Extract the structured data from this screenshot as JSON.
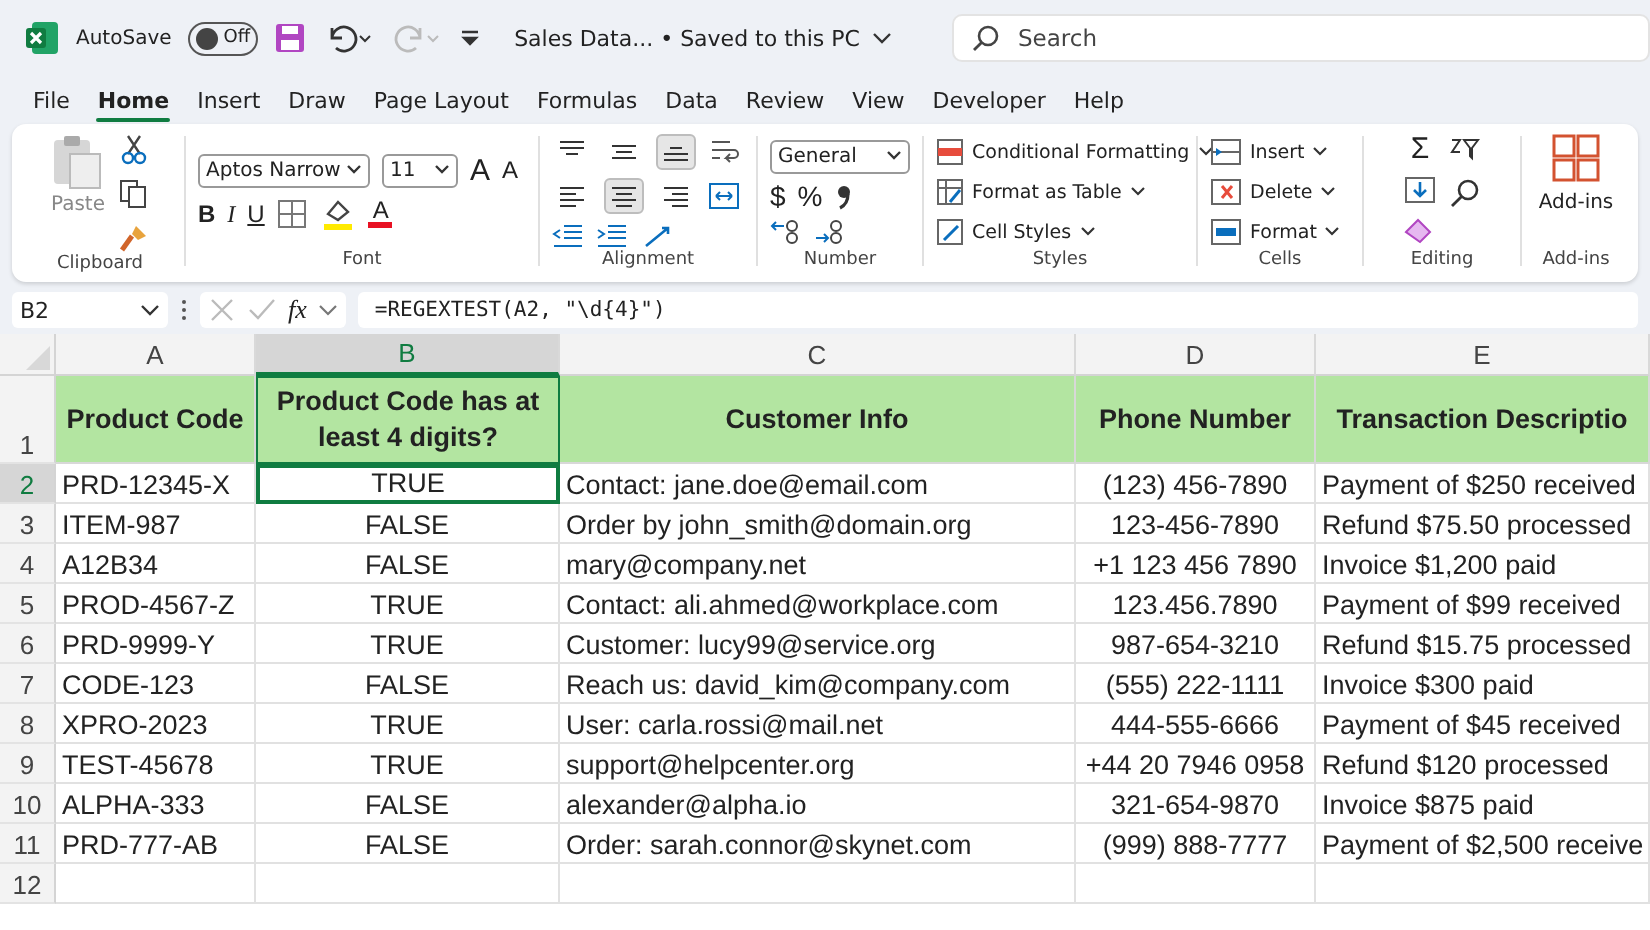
{
  "title_bar": {
    "autosave_label": "AutoSave",
    "autosave_toggle": {
      "label": "Off",
      "on": false
    },
    "document_title": "Sales Data...  •  Saved to this PC",
    "search": {
      "placeholder": "Search"
    }
  },
  "menu_tabs": [
    {
      "label": "File",
      "selected": false
    },
    {
      "label": "Home",
      "selected": true
    },
    {
      "label": "Insert",
      "selected": false
    },
    {
      "label": "Draw",
      "selected": false
    },
    {
      "label": "Page Layout",
      "selected": false
    },
    {
      "label": "Formulas",
      "selected": false
    },
    {
      "label": "Data",
      "selected": false
    },
    {
      "label": "Review",
      "selected": false
    },
    {
      "label": "View",
      "selected": false
    },
    {
      "label": "Developer",
      "selected": false
    },
    {
      "label": "Help",
      "selected": false
    }
  ],
  "ribbon": {
    "clipboard": {
      "label": "Clipboard",
      "paste": "Paste"
    },
    "font": {
      "label": "Font",
      "family": "Aptos Narrow",
      "size": "11",
      "grow": "A",
      "shrink": "A",
      "bold": "B",
      "italic": "I",
      "underline": "U",
      "font_color": "A"
    },
    "alignment": {
      "label": "Alignment",
      "vertical": [
        {
          "kind": "top",
          "selected": false
        },
        {
          "kind": "middle",
          "selected": false
        },
        {
          "kind": "bottom",
          "selected": true
        }
      ],
      "horizontal": [
        {
          "kind": "left",
          "selected": false
        },
        {
          "kind": "center",
          "selected": true
        },
        {
          "kind": "right",
          "selected": false
        }
      ]
    },
    "number": {
      "label": "Number",
      "format": "General",
      "currency": "$",
      "percent": "%"
    },
    "styles": {
      "label": "Styles",
      "items": [
        {
          "kind": "conditional",
          "label": "Conditional Formatting"
        },
        {
          "kind": "table",
          "label": "Format as Table"
        },
        {
          "kind": "cell",
          "label": "Cell Styles"
        }
      ]
    },
    "cells": {
      "label": "Cells",
      "items": [
        {
          "kind": "insert",
          "label": "Insert"
        },
        {
          "kind": "delete",
          "label": "Delete"
        },
        {
          "kind": "format",
          "label": "Format"
        }
      ]
    },
    "editing": {
      "label": "Editing",
      "sum": "Σ"
    },
    "addins": {
      "label": "Add-ins",
      "button": "Add-ins"
    }
  },
  "formula_bar": {
    "name_box": "B2",
    "fx": "fx",
    "formula": "=REGEXTEST(A2, \"\\d{4}\")"
  },
  "sheet": {
    "columns": [
      {
        "letter": "A",
        "selected": false
      },
      {
        "letter": "B",
        "selected": true
      },
      {
        "letter": "C",
        "selected": false
      },
      {
        "letter": "D",
        "selected": false
      },
      {
        "letter": "E",
        "selected": false
      }
    ],
    "header_row": {
      "number": "1",
      "cells": [
        "Product Code",
        "Product Code has at least 4 digits?",
        "Customer Info",
        "Phone Number",
        "Transaction Descriptio"
      ]
    },
    "rows": [
      {
        "number": "2",
        "cells": [
          {
            "text": "PRD-12345-X",
            "selected": false
          },
          {
            "text": "TRUE",
            "selected": true
          },
          {
            "text": "Contact: jane.doe@email.com",
            "selected": false
          },
          {
            "text": "(123) 456-7890",
            "selected": false
          },
          {
            "text": "Payment of $250 received",
            "selected": false
          }
        ]
      },
      {
        "number": "3",
        "cells": [
          {
            "text": "ITEM-987",
            "selected": false
          },
          {
            "text": "FALSE",
            "selected": false
          },
          {
            "text": "Order by john_smith@domain.org",
            "selected": false
          },
          {
            "text": "123-456-7890",
            "selected": false
          },
          {
            "text": "Refund $75.50 processed",
            "selected": false
          }
        ]
      },
      {
        "number": "4",
        "cells": [
          {
            "text": "A12B34",
            "selected": false
          },
          {
            "text": "FALSE",
            "selected": false
          },
          {
            "text": "mary@company.net",
            "selected": false
          },
          {
            "text": "+1 123 456 7890",
            "selected": false
          },
          {
            "text": "Invoice $1,200 paid",
            "selected": false
          }
        ]
      },
      {
        "number": "5",
        "cells": [
          {
            "text": "PROD-4567-Z",
            "selected": false
          },
          {
            "text": "TRUE",
            "selected": false
          },
          {
            "text": "Contact: ali.ahmed@workplace.com",
            "selected": false
          },
          {
            "text": "123.456.7890",
            "selected": false
          },
          {
            "text": "Payment of $99 received",
            "selected": false
          }
        ]
      },
      {
        "number": "6",
        "cells": [
          {
            "text": "PRD-9999-Y",
            "selected": false
          },
          {
            "text": "TRUE",
            "selected": false
          },
          {
            "text": "Customer: lucy99@service.org",
            "selected": false
          },
          {
            "text": "987-654-3210",
            "selected": false
          },
          {
            "text": "Refund $15.75 processed",
            "selected": false
          }
        ]
      },
      {
        "number": "7",
        "cells": [
          {
            "text": "CODE-123",
            "selected": false
          },
          {
            "text": "FALSE",
            "selected": false
          },
          {
            "text": "Reach us: david_kim@company.com",
            "selected": false
          },
          {
            "text": "(555) 222-1111",
            "selected": false
          },
          {
            "text": "Invoice $300 paid",
            "selected": false
          }
        ]
      },
      {
        "number": "8",
        "cells": [
          {
            "text": "XPRO-2023",
            "selected": false
          },
          {
            "text": "TRUE",
            "selected": false
          },
          {
            "text": "User: carla.rossi@mail.net",
            "selected": false
          },
          {
            "text": "444-555-6666",
            "selected": false
          },
          {
            "text": "Payment of $45 received",
            "selected": false
          }
        ]
      },
      {
        "number": "9",
        "cells": [
          {
            "text": "TEST-45678",
            "selected": false
          },
          {
            "text": "TRUE",
            "selected": false
          },
          {
            "text": "support@helpcenter.org",
            "selected": false
          },
          {
            "text": "+44 20 7946 0958",
            "selected": false
          },
          {
            "text": "Refund $120 processed",
            "selected": false
          }
        ]
      },
      {
        "number": "10",
        "cells": [
          {
            "text": "ALPHA-333",
            "selected": false
          },
          {
            "text": "FALSE",
            "selected": false
          },
          {
            "text": "alexander@alpha.io",
            "selected": false
          },
          {
            "text": "321-654-9870",
            "selected": false
          },
          {
            "text": "Invoice $875 paid",
            "selected": false
          }
        ]
      },
      {
        "number": "11",
        "cells": [
          {
            "text": "PRD-777-AB",
            "selected": false
          },
          {
            "text": "FALSE",
            "selected": false
          },
          {
            "text": "Order: sarah.connor@skynet.com",
            "selected": false
          },
          {
            "text": "(999) 888-7777",
            "selected": false
          },
          {
            "text": "Payment of $2,500 receive",
            "selected": false
          }
        ]
      }
    ],
    "empty_rows": [
      "12"
    ]
  }
}
